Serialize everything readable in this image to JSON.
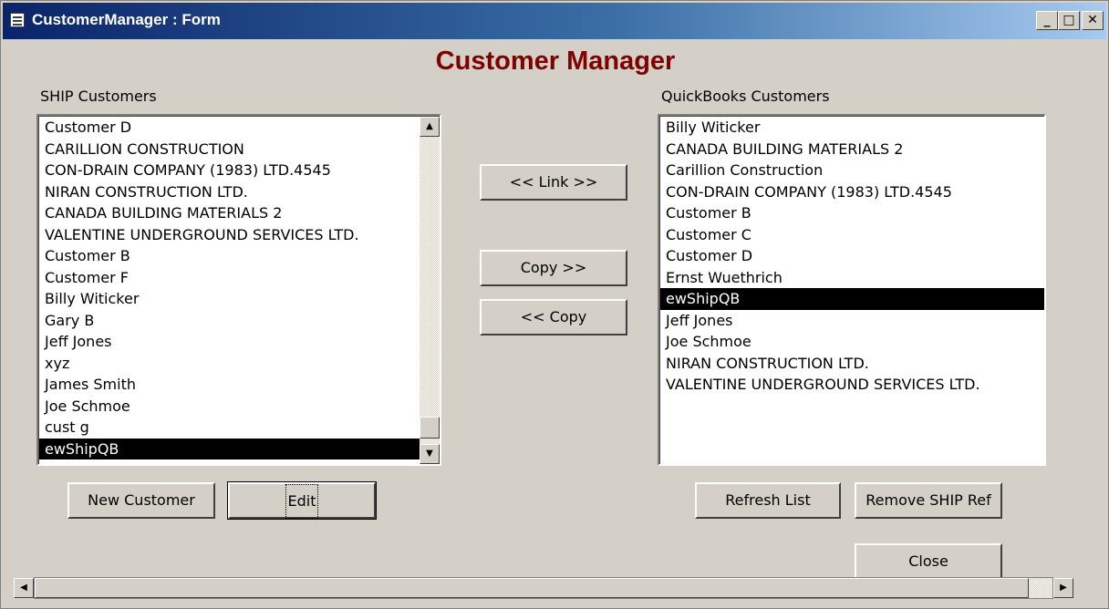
{
  "window": {
    "title": "CustomerManager : Form",
    "minimize": "_",
    "maximize": "□",
    "close": "✕"
  },
  "form_title": "Customer Manager",
  "ship": {
    "label": "SHIP Customers",
    "items": [
      "Customer D",
      "CARILLION CONSTRUCTION",
      "CON-DRAIN COMPANY (1983) LTD.4545",
      "NIRAN CONSTRUCTION LTD.",
      "CANADA BUILDING MATERIALS 2",
      "VALENTINE UNDERGROUND SERVICES LTD.",
      "Customer B",
      "Customer F",
      "Billy Witicker",
      "Gary B",
      "Jeff Jones",
      "xyz",
      "James Smith",
      "Joe Schmoe",
      "cust g",
      "ewShipQB"
    ],
    "selected": "ewShipQB"
  },
  "quickbooks": {
    "label": "QuickBooks Customers",
    "items": [
      "Billy Witicker",
      "CANADA BUILDING MATERIALS 2",
      "Carillion Construction",
      "CON-DRAIN COMPANY (1983) LTD.4545",
      "Customer B",
      "Customer C",
      "Customer D",
      "Ernst Wuethrich",
      "ewShipQB",
      "Jeff Jones",
      "Joe Schmoe",
      "NIRAN CONSTRUCTION LTD.",
      "VALENTINE UNDERGROUND SERVICES LTD."
    ],
    "selected": "ewShipQB"
  },
  "buttons": {
    "link": "<< Link >>",
    "copy_right": "Copy >>",
    "copy_left": "<< Copy",
    "new_customer": "New Customer",
    "edit": "Edit",
    "refresh_list": "Refresh List",
    "remove_ship_ref": "Remove SHIP Ref",
    "close": "Close"
  }
}
